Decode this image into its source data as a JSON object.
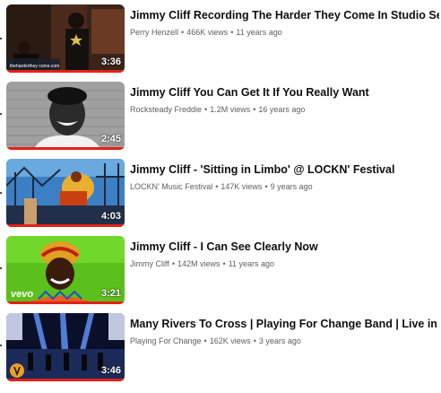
{
  "videos": [
    {
      "title": "Jimmy Cliff Recording The Harder They Come In Studio Session",
      "channel": "Perry Henzell",
      "views": "466K views",
      "age": "11 years ago",
      "duration": "3:36",
      "watermark": "theharderthey come.com",
      "progress": 1.0
    },
    {
      "title": "Jimmy Cliff You Can Get It If You Really Want",
      "channel": "Rocksteady Freddie",
      "views": "1.2M views",
      "age": "16 years ago",
      "duration": "2:45",
      "progress": 1.0
    },
    {
      "title": "Jimmy Cliff - 'Sitting in Limbo' @ LOCKN' Festival",
      "channel": "LOCKN' Music Festival",
      "views": "147K views",
      "age": "9 years ago",
      "duration": "4:03",
      "progress": 1.0
    },
    {
      "title": "Jimmy Cliff - I Can See Clearly Now",
      "channel": "Jimmy Cliff",
      "views": "142M views",
      "age": "11 years ago",
      "duration": "3:21",
      "watermark": "vevo",
      "progress": 1.0
    },
    {
      "title": "Many Rivers To Cross | Playing For Change Band | Live in Dubai",
      "channel": "Playing For Change",
      "views": "162K views",
      "age": "3 years ago",
      "duration": "3:46",
      "progress": 1.0
    }
  ],
  "separator": "•",
  "colors": {
    "progress": "#e62117",
    "title": "#0f0f0f",
    "meta": "#606060"
  }
}
